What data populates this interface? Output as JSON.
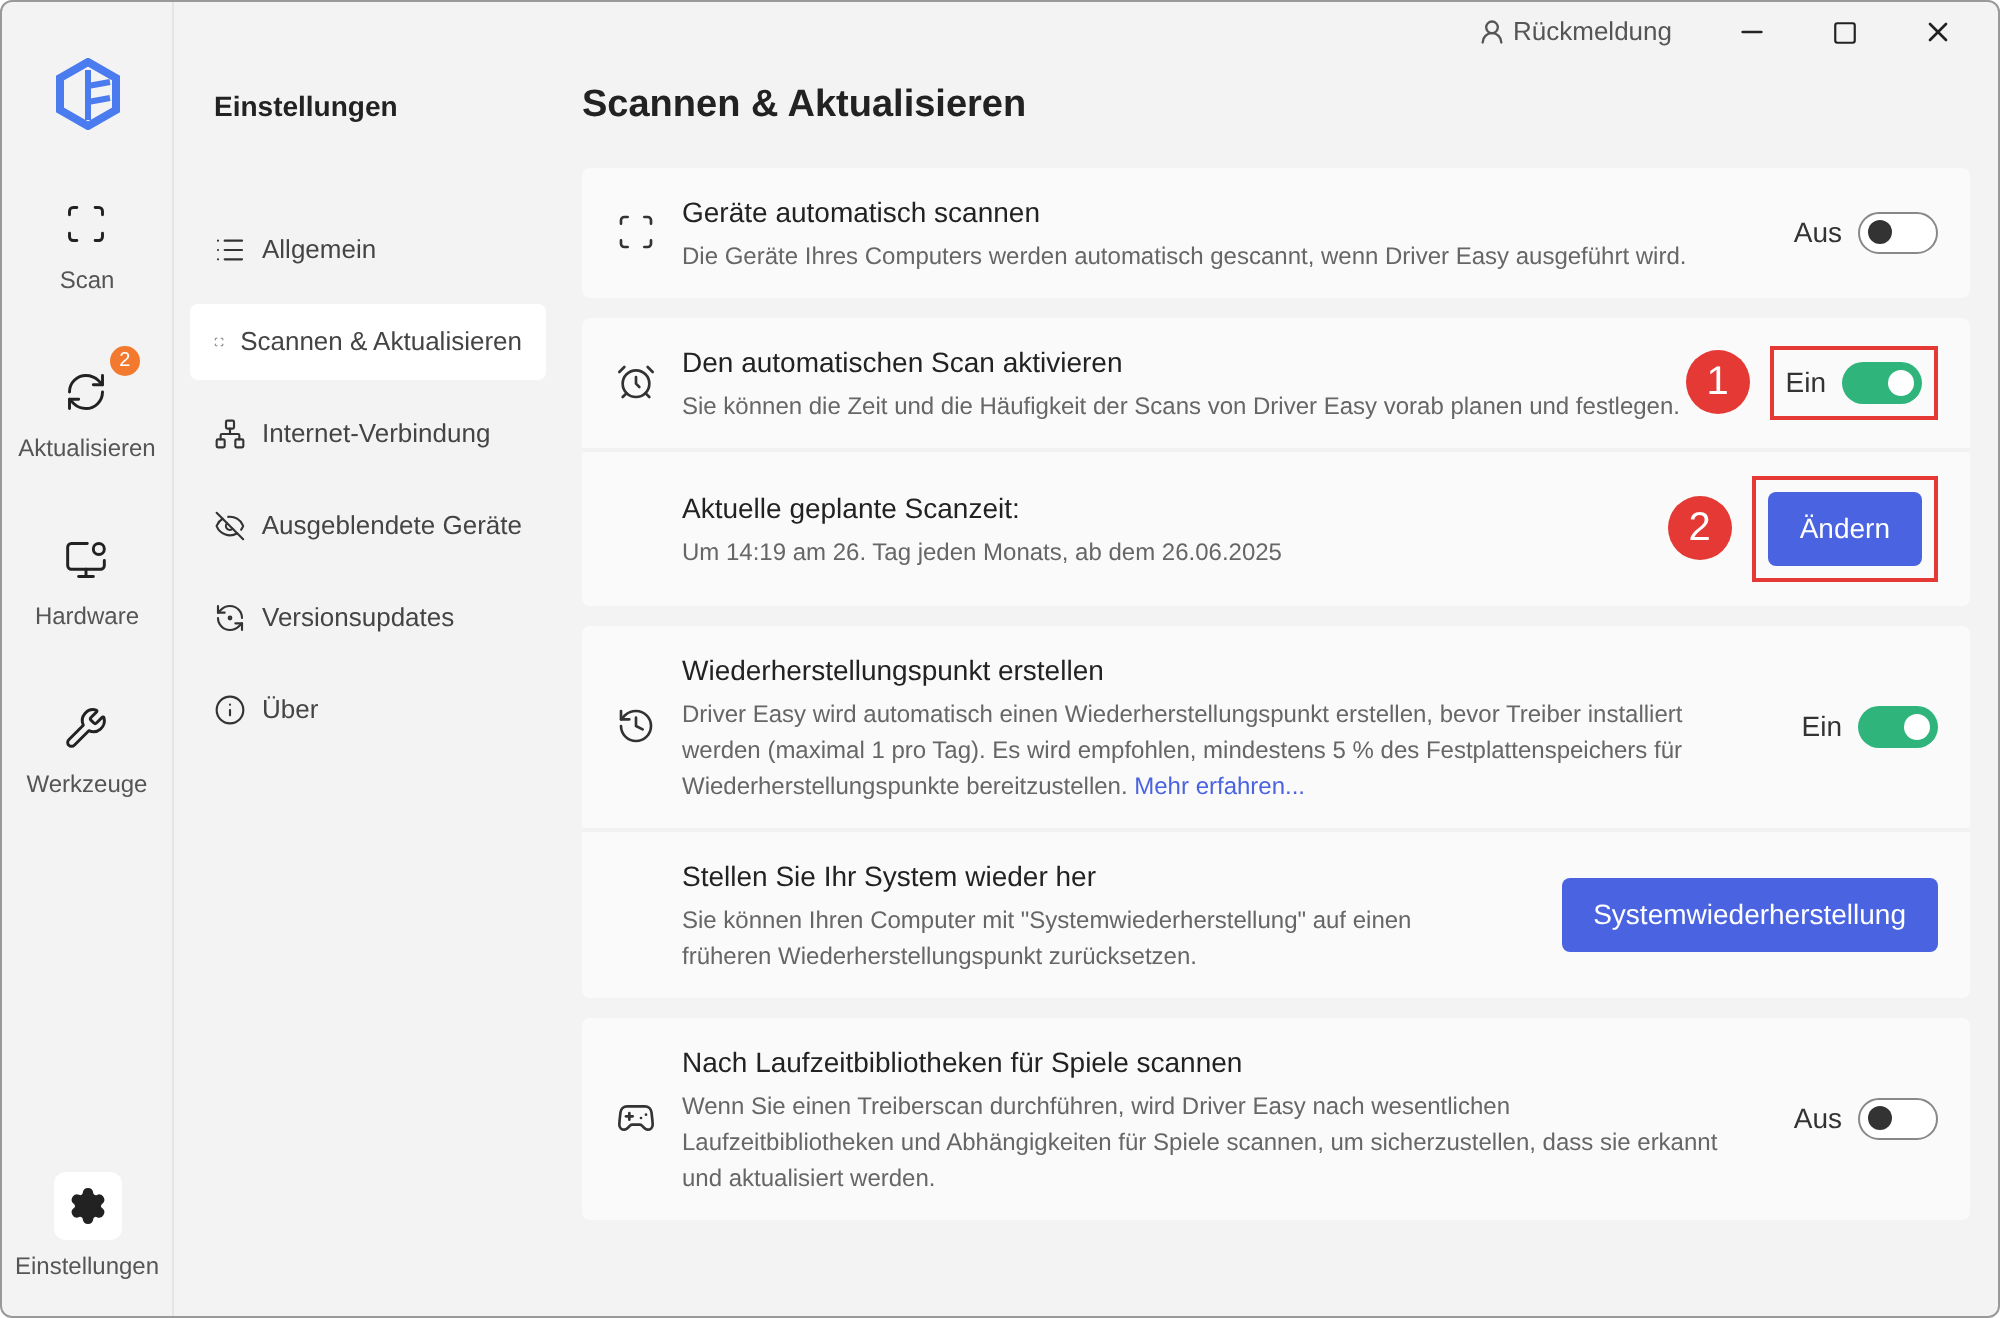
{
  "rail": {
    "items": [
      {
        "label": "Scan",
        "selected": false
      },
      {
        "label": "Aktualisieren",
        "badge": "2",
        "selected": false
      },
      {
        "label": "Hardware",
        "selected": false
      },
      {
        "label": "Werkzeuge",
        "selected": false
      }
    ],
    "bottom": {
      "label": "Einstellungen",
      "selected": true
    }
  },
  "nav": {
    "title": "Einstellungen",
    "items": [
      {
        "label": "Allgemein",
        "selected": false
      },
      {
        "label": "Scannen & Aktualisieren",
        "selected": true
      },
      {
        "label": "Internet-Verbindung",
        "selected": false
      },
      {
        "label": "Ausgeblendete Geräte",
        "selected": false
      },
      {
        "label": "Versionsupdates",
        "selected": false
      },
      {
        "label": "Über",
        "selected": false
      }
    ]
  },
  "titlebar": {
    "feedback": "Rückmeldung"
  },
  "page_title": "Scannen & Aktualisieren",
  "sections": [
    {
      "rows": [
        {
          "kind": "toggle",
          "title": "Geräte automatisch scannen",
          "desc": "Die Geräte Ihres Computers werden automatisch gescannt, wenn Driver Easy ausgeführt wird.",
          "toggle": {
            "label": "Aus",
            "on": false
          }
        }
      ]
    },
    {
      "rows": [
        {
          "kind": "toggle",
          "title": "Den automatischen Scan aktivieren",
          "desc": "Sie können die Zeit und die Häufigkeit der Scans von Driver Easy vorab planen und festlegen.",
          "toggle": {
            "label": "Ein",
            "on": true
          },
          "annotation": "1"
        },
        {
          "kind": "button",
          "title": "Aktuelle geplante Scanzeit:",
          "desc": "Um 14:19 am 26. Tag jeden Monats, ab dem 26.06.2025",
          "button": "Ändern",
          "annotation": "2"
        }
      ]
    },
    {
      "rows": [
        {
          "kind": "toggle",
          "title": "Wiederherstellungspunkt erstellen",
          "desc": "Driver Easy wird automatisch einen Wiederherstellungspunkt erstellen, bevor Treiber installiert werden (maximal 1 pro Tag). Es wird empfohlen, mindestens 5 % des Festplattenspeichers für Wiederherstellungspunkte bereitzustellen.",
          "link": "Mehr erfahren...",
          "toggle": {
            "label": "Ein",
            "on": true
          }
        },
        {
          "kind": "button",
          "title": "Stellen Sie Ihr System wieder her",
          "desc": "Sie können Ihren Computer mit \"Systemwiederherstellung\" auf einen früheren Wiederherstellungspunkt zurücksetzen.",
          "button": "Systemwiederherstellung"
        }
      ]
    },
    {
      "rows": [
        {
          "kind": "toggle",
          "title": "Nach Laufzeitbibliotheken für Spiele scannen",
          "desc": "Wenn Sie einen Treiberscan durchführen, wird Driver Easy nach wesentlichen Laufzeitbibliotheken und Abhängigkeiten für Spiele scannen, um sicherzustellen, dass sie erkannt und aktualisiert werden.",
          "toggle": {
            "label": "Aus",
            "on": false
          }
        }
      ]
    }
  ]
}
